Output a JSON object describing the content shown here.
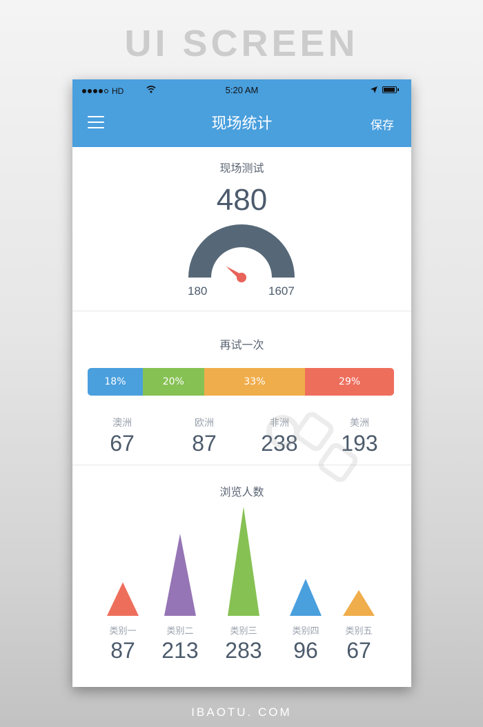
{
  "poster": {
    "title": "UI SCREEN",
    "footer": "IBAOTU. COM"
  },
  "status_bar": {
    "carrier": "HD",
    "time": "5:20 AM"
  },
  "nav": {
    "title": "现场统计",
    "save_label": "保存"
  },
  "gauge_section": {
    "title": "现场测试",
    "value": "480",
    "min_label": "180",
    "max_label": "1607",
    "needle_fraction": 0.2,
    "colors": {
      "arc": "#566878",
      "needle": "#e8635a"
    }
  },
  "retry_section": {
    "title": "再试一次",
    "segments": [
      {
        "label": "18%",
        "percent": 18,
        "color": "#4a9fdd"
      },
      {
        "label": "20%",
        "percent": 20,
        "color": "#86c154"
      },
      {
        "label": "33%",
        "percent": 33,
        "color": "#f0ad4b"
      },
      {
        "label": "29%",
        "percent": 29,
        "color": "#ee6e5c"
      }
    ],
    "regions": [
      {
        "name": "澳洲",
        "value": "67"
      },
      {
        "name": "欧洲",
        "value": "87"
      },
      {
        "name": "非洲",
        "value": "238"
      },
      {
        "name": "美洲",
        "value": "193"
      }
    ]
  },
  "views_section": {
    "title": "浏览人数"
  },
  "chart_data": {
    "type": "bar",
    "title": "浏览人数",
    "categories": [
      "类别一",
      "类别二",
      "类别三",
      "类别四",
      "类别五"
    ],
    "values": [
      87,
      213,
      283,
      96,
      67
    ],
    "colors": [
      "#ee6e5c",
      "#9575b5",
      "#86c154",
      "#4a9fdd",
      "#f0ad4b"
    ],
    "ylim": [
      0,
      283
    ],
    "grid": false,
    "legend": "none"
  }
}
